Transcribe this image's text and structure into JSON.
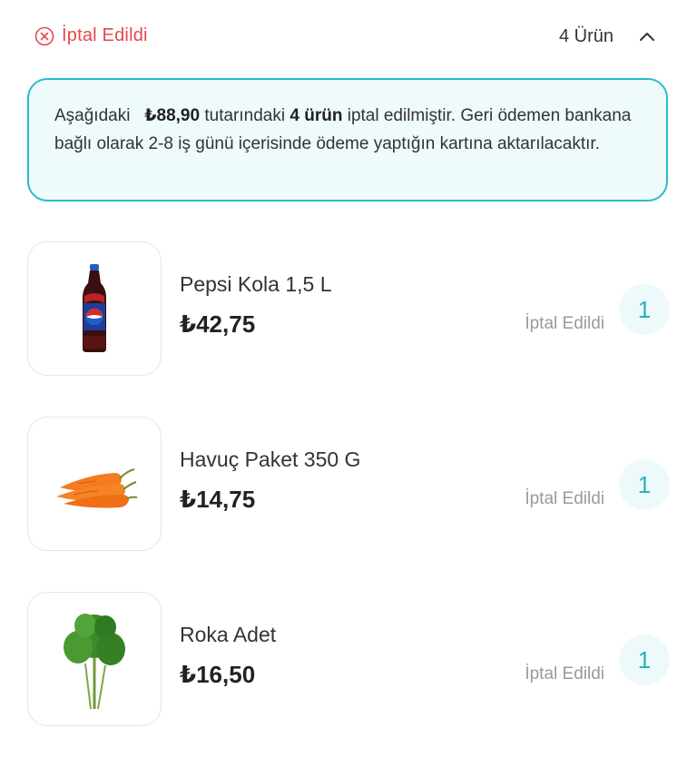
{
  "header": {
    "status_label": "İptal Edildi",
    "status_icon": "close-circle-icon",
    "status_color": "#e5484d",
    "item_count": "4 Ürün",
    "collapse_icon": "chevron-up-icon"
  },
  "notice": {
    "part1": "Aşağıdaki",
    "amount": "₺88,90",
    "part2": "tutarındaki",
    "count": "4 ürün",
    "part3": "iptal edilmiştir. Geri ödemen bankana bağlı olarak 2-8 iş günü içerisinde ödeme yaptığın kartına aktarılacaktır.",
    "border_color": "#2bbcc8"
  },
  "items": [
    {
      "name": "Pepsi Kola 1,5 L",
      "price": "₺42,75",
      "status": "İptal Edildi",
      "qty": "1",
      "image": "pepsi-bottle-image"
    },
    {
      "name": "Havuç Paket 350 G",
      "price": "₺14,75",
      "status": "İptal Edildi",
      "qty": "1",
      "image": "carrots-image"
    },
    {
      "name": "Roka Adet",
      "price": "₺16,50",
      "status": "İptal Edildi",
      "qty": "1",
      "image": "arugula-image"
    }
  ],
  "accent_color": "#25b3c0"
}
